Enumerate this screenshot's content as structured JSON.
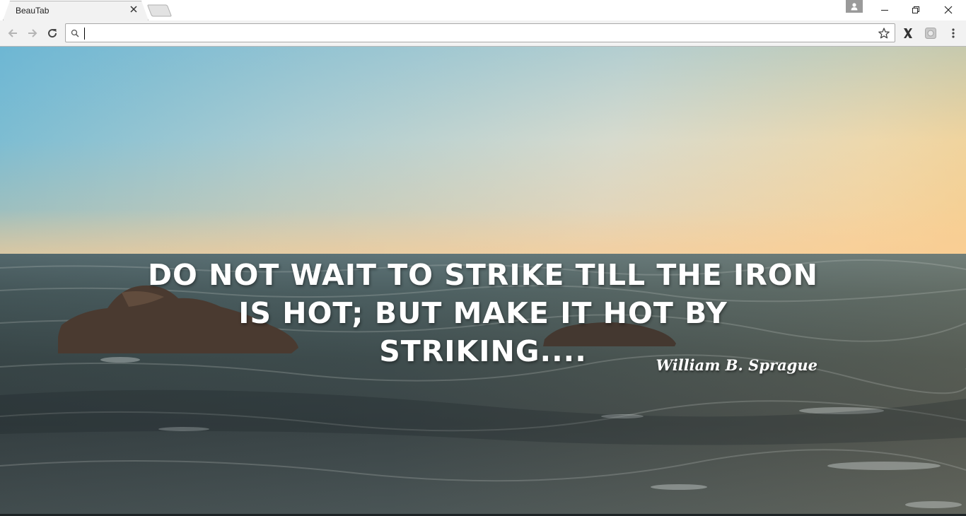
{
  "browser": {
    "tab": {
      "title": "BeauTab"
    },
    "omnibox": {
      "value": "",
      "placeholder": ""
    }
  },
  "icons": {
    "tab_close": "close-icon",
    "new_tab": "new-tab-icon",
    "profile": "person-icon",
    "minimize": "minimize-icon",
    "restore": "restore-icon",
    "close_window": "close-icon",
    "back": "arrow-left-icon",
    "forward": "arrow-right-icon",
    "reload": "reload-icon",
    "search": "search-icon",
    "bookmark": "star-icon",
    "extension_x": "x-extension-icon",
    "extension_2": "extension-icon",
    "menu": "kebab-menu-icon"
  },
  "page": {
    "quote": "Do not wait to strike till the iron is hot; but make it hot by striking....",
    "author": "William B. Sprague"
  },
  "colors": {
    "toolbar": "#f2f2f2",
    "sky_top": "#6db8d4",
    "sky_horizon": "#f9d08a",
    "sea": "#3e4c4d",
    "text": "#ffffff"
  }
}
